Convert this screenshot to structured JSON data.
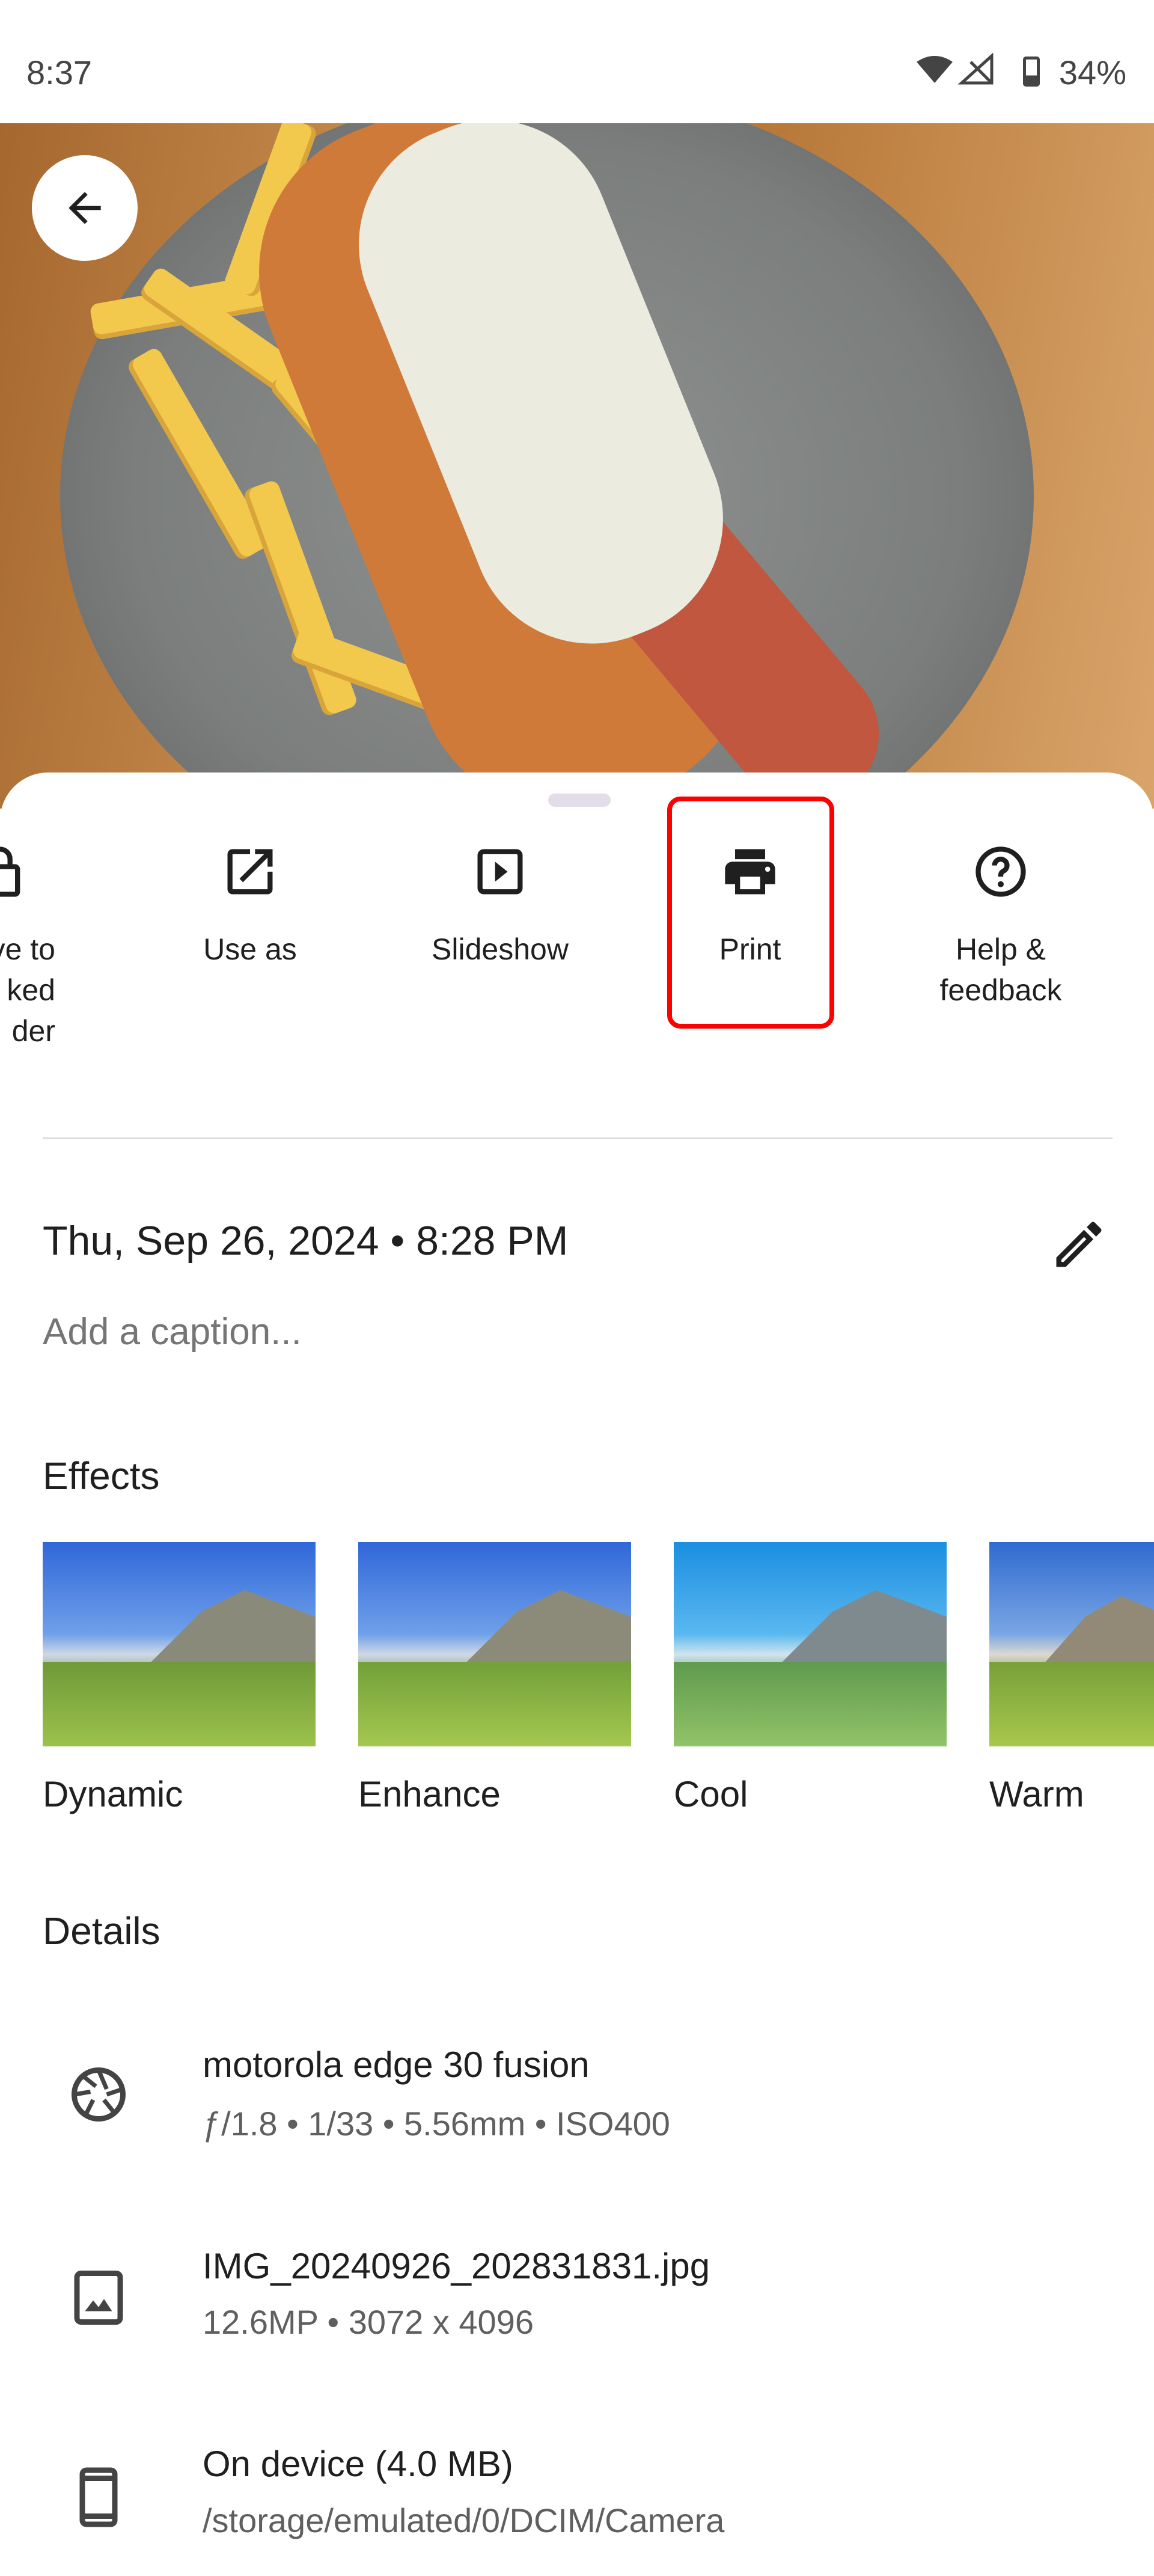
{
  "status": {
    "time": "8:37",
    "battery": "34%",
    "icons": [
      "wifi-icon",
      "signal-icon",
      "battery-icon"
    ]
  },
  "photo": {
    "subject": "hot-dog-and-fries"
  },
  "back_icon": "arrow-back-icon",
  "actions": [
    {
      "label": "Move to locked folder",
      "visible_label": "ve to\nked\nder",
      "icon": "lock-folder-icon"
    },
    {
      "label": "Use as",
      "icon": "open-external-icon"
    },
    {
      "label": "Slideshow",
      "icon": "slideshow-icon"
    },
    {
      "label": "Print",
      "icon": "print-icon",
      "highlighted": true
    },
    {
      "label": "Help & feedback",
      "icon": "help-icon"
    }
  ],
  "highlight_color": "#ff0000",
  "date": "Thu, Sep 26, 2024  •  8:28 PM",
  "caption_placeholder": "Add a caption...",
  "effects": {
    "heading": "Effects",
    "items": [
      "Dynamic",
      "Enhance",
      "Cool",
      "Warm"
    ]
  },
  "details": {
    "heading": "Details",
    "rows": [
      {
        "icon": "camera-aperture-icon",
        "title": "motorola edge 30 fusion",
        "subtitle": "ƒ/1.8  •  1/33  •  5.56mm  •  ISO400"
      },
      {
        "icon": "image-icon",
        "title": "IMG_20240926_202831831.jpg",
        "subtitle": "12.6MP  •  3072 x 4096"
      },
      {
        "icon": "phone-icon",
        "title": "On device (4.0 MB)",
        "subtitle": "/storage/emulated/0/DCIM/Camera"
      }
    ]
  }
}
